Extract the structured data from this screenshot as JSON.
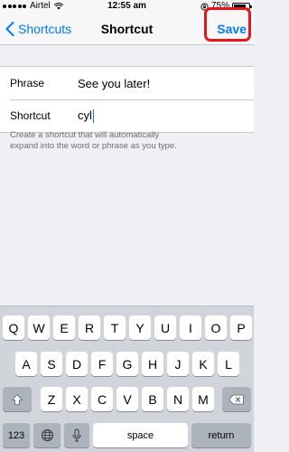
{
  "status_bar": {
    "carrier": "Airtel",
    "time": "12:55 am",
    "battery_percent": "75%",
    "battery_level": 0.75
  },
  "nav": {
    "back_label": "Shortcuts",
    "title": "Shortcut",
    "save_label": "Save"
  },
  "form": {
    "phrase_label": "Phrase",
    "phrase_value": "See you later!",
    "shortcut_label": "Shortcut",
    "shortcut_value": "cyl",
    "help_text": "Create a shortcut that will automatically expand into the word or phrase as you type."
  },
  "keyboard": {
    "row1": [
      "Q",
      "W",
      "E",
      "R",
      "T",
      "Y",
      "U",
      "I",
      "O",
      "P"
    ],
    "row2": [
      "A",
      "S",
      "D",
      "F",
      "G",
      "H",
      "J",
      "K",
      "L"
    ],
    "row3": [
      "Z",
      "X",
      "C",
      "V",
      "B",
      "N",
      "M"
    ],
    "numbers_key": "123",
    "space_key": "space",
    "return_key": "return",
    "icons": {
      "shift": "shift-arrow-icon",
      "delete": "delete-backspace-icon",
      "globe": "globe-icon",
      "mic": "microphone-icon"
    }
  },
  "colors": {
    "accent": "#007aff",
    "highlight": "#e8141b"
  }
}
